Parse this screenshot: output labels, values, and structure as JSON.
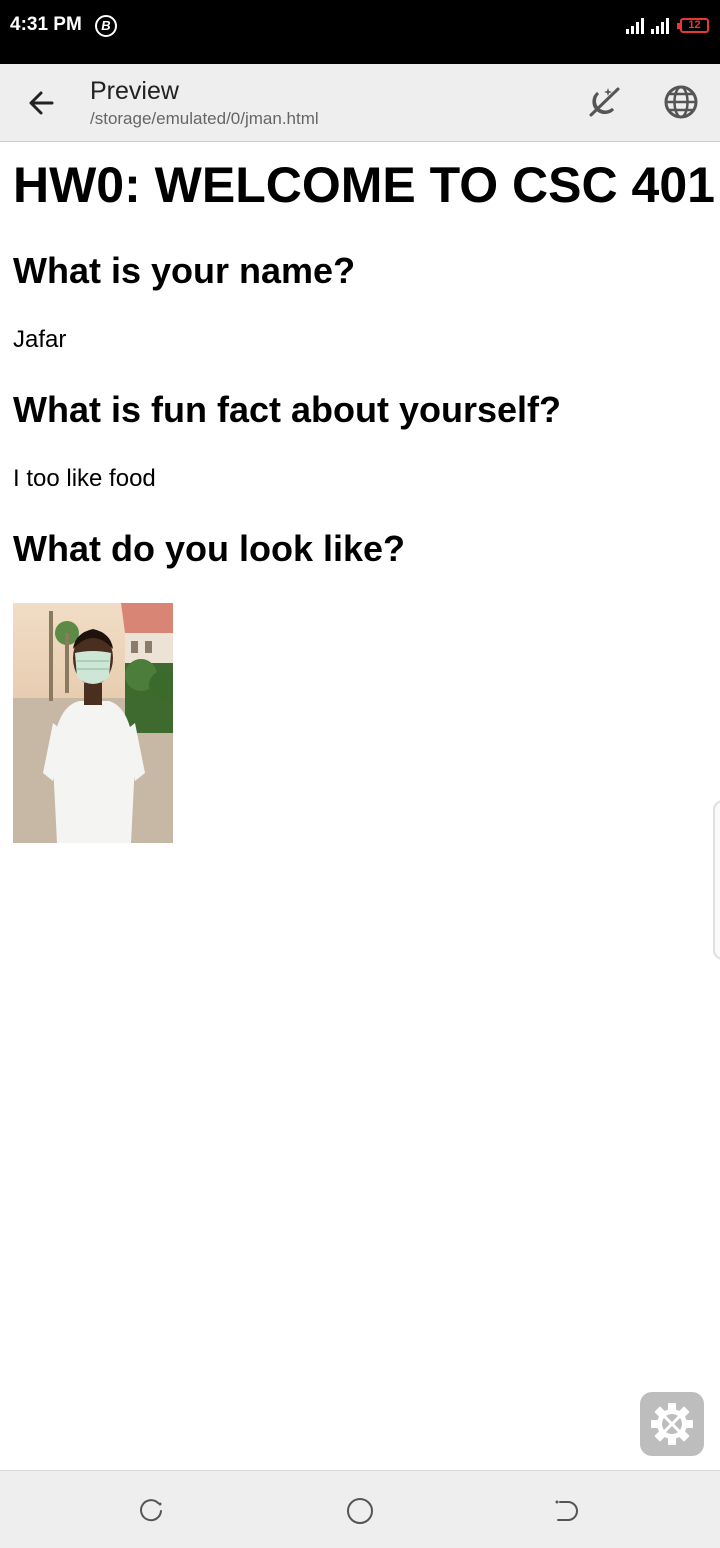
{
  "status_bar": {
    "time": "4:31 PM",
    "notification_badge": "B",
    "battery_level": "12",
    "battery_color": "#e53935"
  },
  "app_bar": {
    "title": "Preview",
    "subtitle": "/storage/emulated/0/jman.html",
    "back_icon": "arrow-left-icon",
    "night_mode_icon": "night-mode-off-icon",
    "browser_icon": "globe-icon"
  },
  "page": {
    "heading": "HW0: WELCOME TO CSC 401",
    "sections": [
      {
        "question": "What is your name?",
        "answer": "Jafar"
      },
      {
        "question": "What is fun fact about yourself?",
        "answer": "I too like food"
      },
      {
        "question": "What do you look like?",
        "answer": ""
      }
    ]
  },
  "fab": {
    "icon": "tools-gear-icon"
  },
  "nav_bar": {
    "recent_icon": "recent-apps-icon",
    "home_icon": "home-circle-icon",
    "back_icon": "back-nav-icon"
  }
}
